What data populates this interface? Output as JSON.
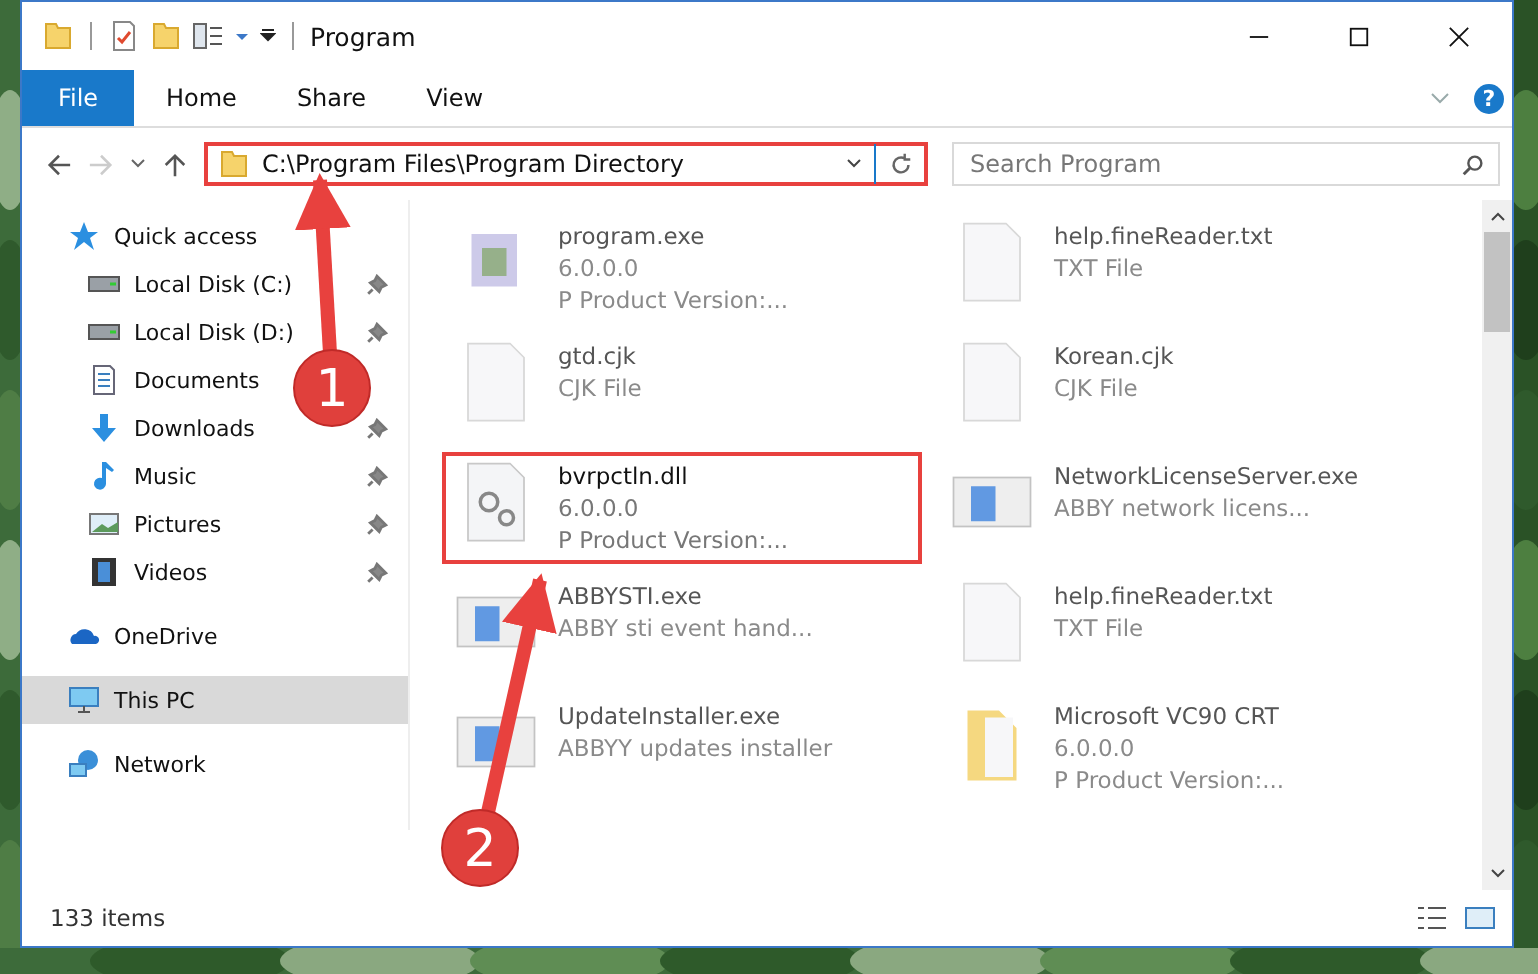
{
  "window": {
    "title": "Program",
    "help_glyph": "?"
  },
  "ribbon_tabs": [
    {
      "label": "File",
      "kind": "file",
      "selected": false
    },
    {
      "label": "Home",
      "kind": "tab",
      "selected": false
    },
    {
      "label": "Share",
      "kind": "tab",
      "selected": false
    },
    {
      "label": "View",
      "kind": "tab",
      "selected": false
    }
  ],
  "address_bar": {
    "path": "C:\\Program Files\\Program Directory",
    "highlighted": true
  },
  "search": {
    "placeholder": "Search Program"
  },
  "sidebar": {
    "items": [
      {
        "label": "Quick access",
        "kind": "star",
        "selected": false,
        "children": [
          {
            "label": "Local Disk (C:)",
            "kind": "drive",
            "pinned": true,
            "selected": false
          },
          {
            "label": "Local Disk (D:)",
            "kind": "drive",
            "pinned": true,
            "selected": false
          },
          {
            "label": "Documents",
            "kind": "documents",
            "selected": false
          },
          {
            "label": "Downloads",
            "kind": "download",
            "pinned": true,
            "selected": false
          },
          {
            "label": "Music",
            "kind": "music",
            "pinned": true,
            "selected": false
          },
          {
            "label": "Pictures",
            "kind": "pictures",
            "pinned": true,
            "selected": false
          },
          {
            "label": "Videos",
            "kind": "videos",
            "pinned": true,
            "selected": false
          }
        ]
      },
      {
        "label": "OneDrive",
        "kind": "cloud",
        "selected": false
      },
      {
        "label": "This PC",
        "kind": "pc",
        "selected": true
      },
      {
        "label": "Network",
        "kind": "network",
        "selected": false
      }
    ]
  },
  "files": [
    {
      "name": "program.exe",
      "lines": [
        "6.0.0.0",
        "P  Product Version:..."
      ],
      "kind": "app",
      "blurred": true,
      "highlighted": false
    },
    {
      "name": "help.fineReader.txt",
      "lines": [
        "TXT File"
      ],
      "kind": "blank",
      "blurred": true,
      "highlighted": false
    },
    {
      "name": "gtd.cjk",
      "lines": [
        "CJK File"
      ],
      "kind": "blank",
      "blurred": true,
      "highlighted": false
    },
    {
      "name": "Korean.cjk",
      "lines": [
        "CJK File"
      ],
      "kind": "blank",
      "blurred": true,
      "highlighted": false
    },
    {
      "name": "bvrpctln.dll",
      "lines": [
        "6.0.0.0",
        "P  Product Version:..."
      ],
      "kind": "gear",
      "blurred": false,
      "highlighted": true
    },
    {
      "name": "NetworkLicenseServer.exe",
      "lines": [
        "ABBY network licens..."
      ],
      "kind": "window",
      "blurred": true,
      "highlighted": false
    },
    {
      "name": "ABBYSTI.exe",
      "lines": [
        "ABBY sti event hand..."
      ],
      "kind": "window",
      "blurred": true,
      "highlighted": false
    },
    {
      "name": "help.fineReader.txt",
      "lines": [
        "TXT File"
      ],
      "kind": "blank",
      "blurred": true,
      "highlighted": false
    },
    {
      "name": "UpdateInstaller.exe",
      "lines": [
        "ABBYY updates installer"
      ],
      "kind": "window",
      "blurred": true,
      "highlighted": false
    },
    {
      "name": "Microsoft VC90 CRT",
      "lines": [
        "6.0.0.0",
        "P  Product Version:..."
      ],
      "kind": "folder",
      "blurred": true,
      "highlighted": false
    }
  ],
  "status_bar": {
    "item_count": "133 items"
  },
  "callouts": [
    {
      "number": "1"
    },
    {
      "number": "2"
    }
  ]
}
